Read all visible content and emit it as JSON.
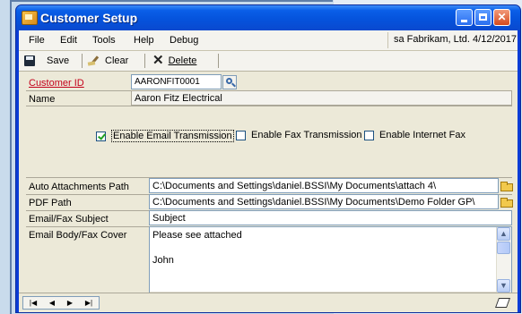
{
  "window": {
    "title": "Customer Setup",
    "controls": [
      "minimize-icon",
      "maximize-icon",
      "close-icon"
    ]
  },
  "menu": {
    "items": [
      "File",
      "Edit",
      "Tools",
      "Help",
      "Debug"
    ],
    "context": "sa  Fabrikam, Ltd.  4/12/2017"
  },
  "toolbar": {
    "save_label": "Save",
    "clear_label": "Clear",
    "delete_label": "Delete"
  },
  "form": {
    "customer_id_label": "Customer ID",
    "customer_id_value": "AARONFIT0001",
    "name_label": "Name",
    "name_value": "Aaron Fitz Electrical",
    "enable_email_label": "Enable Email Transmission",
    "enable_email_checked": true,
    "enable_fax_label": "Enable Fax Transmission",
    "enable_fax_checked": false,
    "enable_internet_fax_label": "Enable Internet Fax",
    "enable_internet_fax_checked": false,
    "auto_attach_label": "Auto Attachments Path",
    "auto_attach_value": "C:\\Documents and Settings\\daniel.BSSI\\My Documents\\attach 4\\",
    "pdf_path_label": "PDF Path",
    "pdf_path_value": "C:\\Documents and Settings\\daniel.BSSI\\My Documents\\Demo Folder GP\\",
    "subject_label": "Email/Fax Subject",
    "subject_value": "Subject",
    "body_label": "Email Body/Fax Cover",
    "body_value": "Please see attached\n\nJohn"
  },
  "status": {
    "nav": [
      "|◀",
      "◀",
      "▶",
      "▶|"
    ]
  },
  "colors": {
    "titlebar": "#0553dc",
    "required_label": "#c4001a",
    "client_bg": "#ece9d8"
  }
}
